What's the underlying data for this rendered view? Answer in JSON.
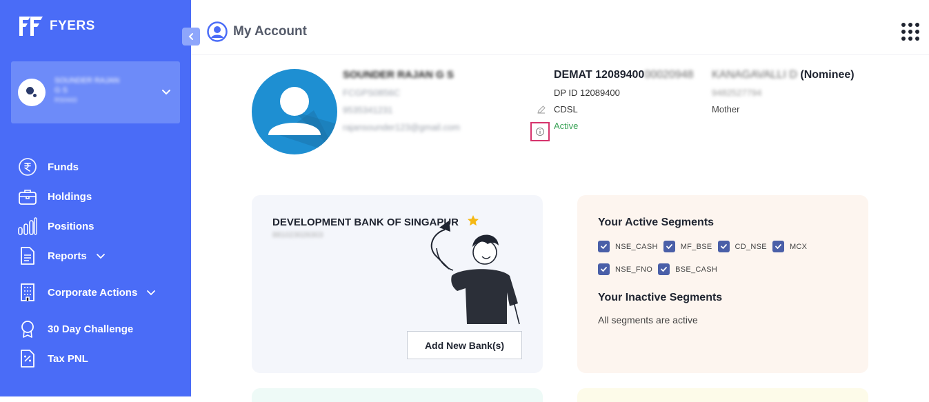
{
  "app": {
    "brand": "FYERS"
  },
  "sidebar": {
    "profile": {
      "name_line1": "SOUNDER RAJAN",
      "name_line2": "G S",
      "client_id": "RS0443"
    },
    "items": [
      {
        "label": "Funds",
        "icon": "rupee-icon",
        "has_chevron": false
      },
      {
        "label": "Holdings",
        "icon": "briefcase-icon",
        "has_chevron": false
      },
      {
        "label": "Positions",
        "icon": "bar-chart-icon",
        "has_chevron": false
      },
      {
        "label": "Reports",
        "icon": "document-icon",
        "has_chevron": true
      },
      {
        "label": "Corporate Actions",
        "icon": "building-icon",
        "has_chevron": true
      },
      {
        "label": "30 Day Challenge",
        "icon": "badge-icon",
        "has_chevron": false
      },
      {
        "label": "Tax PNL",
        "icon": "tax-icon",
        "has_chevron": false
      }
    ]
  },
  "header": {
    "title": "My Account"
  },
  "profile": {
    "name": "SOUNDER RAJAN G S",
    "pan": "FCGPS0856C",
    "phone": "9535341231",
    "email": "rajansounder123@gmail.com"
  },
  "demat": {
    "title_prefix": "DEMAT 12089400",
    "title_masked": "00020948",
    "dp_id": "DP ID 12089400",
    "depository": "CDSL",
    "status": "Active"
  },
  "nominee": {
    "name_masked": "KANAGAVALLI D",
    "label": "(Nominee)",
    "phone_masked": "9482527794",
    "relation": "Mother"
  },
  "bank": {
    "name": "DEVELOPMENT BANK OF SINGAPUR",
    "account_masked": "881023026303",
    "add_button": "Add New Bank(s)"
  },
  "segments": {
    "active_title": "Your Active Segments",
    "active": [
      "NSE_CASH",
      "MF_BSE",
      "CD_NSE",
      "MCX",
      "NSE_FNO",
      "BSE_CASH"
    ],
    "inactive_title": "Your Inactive Segments",
    "inactive_text": "All segments are active"
  },
  "colors": {
    "sidebar": "#4a6cf7",
    "active_status": "#3aa357",
    "checkbox": "#4a5fa8",
    "highlight_border": "#d6336c"
  }
}
